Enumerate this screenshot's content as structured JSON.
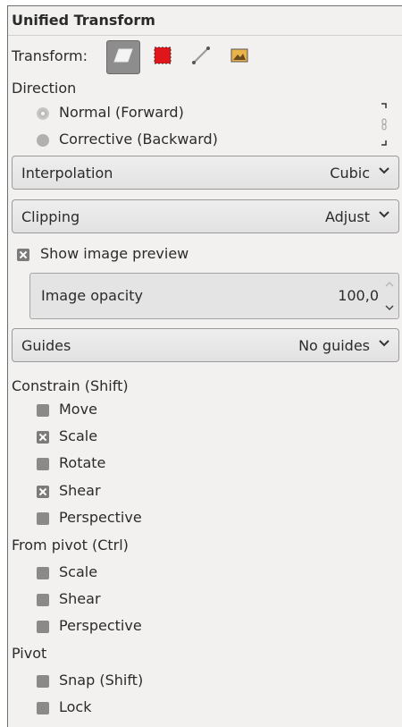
{
  "panel": {
    "title": "Unified Transform"
  },
  "transform": {
    "label": "Transform:",
    "buttons": [
      {
        "icon": "layer-transform-icon",
        "active": true
      },
      {
        "icon": "selection-transform-icon",
        "active": false
      },
      {
        "icon": "path-transform-icon",
        "active": false
      },
      {
        "icon": "image-transform-icon",
        "active": false
      }
    ]
  },
  "direction": {
    "label": "Direction",
    "options": [
      {
        "label": "Normal (Forward)",
        "selected": true
      },
      {
        "label": "Corrective (Backward)",
        "selected": false
      }
    ]
  },
  "interpolation": {
    "label": "Interpolation",
    "value": "Cubic"
  },
  "clipping": {
    "label": "Clipping",
    "value": "Adjust"
  },
  "preview": {
    "label": "Show image preview",
    "checked": true,
    "opacity_label": "Image opacity",
    "opacity_value": "100,0"
  },
  "guides": {
    "label": "Guides",
    "value": "No guides"
  },
  "constrain": {
    "label": "Constrain (Shift)",
    "items": [
      {
        "label": "Move",
        "checked": false
      },
      {
        "label": "Scale",
        "checked": true
      },
      {
        "label": "Rotate",
        "checked": false
      },
      {
        "label": "Shear",
        "checked": true
      },
      {
        "label": "Perspective",
        "checked": false
      }
    ]
  },
  "from_pivot": {
    "label": "From pivot  (Ctrl)",
    "items": [
      {
        "label": "Scale",
        "checked": false
      },
      {
        "label": "Shear",
        "checked": false
      },
      {
        "label": "Perspective",
        "checked": false
      }
    ]
  },
  "pivot": {
    "label": "Pivot",
    "items": [
      {
        "label": "Snap (Shift)",
        "checked": false
      },
      {
        "label": "Lock",
        "checked": false
      }
    ]
  },
  "colors": {
    "active_button": "#8d8d8d",
    "selection_red": "#e0161b",
    "checkbox": "#8a8a8a"
  }
}
